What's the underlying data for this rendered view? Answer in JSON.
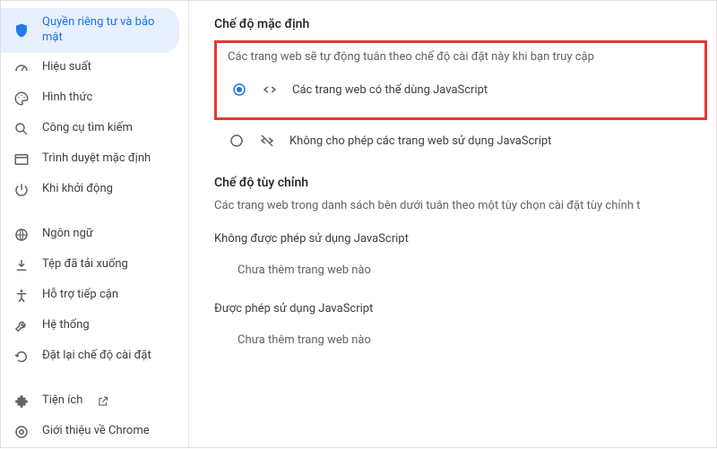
{
  "sidebar": {
    "items": [
      {
        "label": "Quyền riêng tư và bảo mật"
      },
      {
        "label": "Hiệu suất"
      },
      {
        "label": "Hình thức"
      },
      {
        "label": "Công cụ tìm kiếm"
      },
      {
        "label": "Trình duyệt mặc định"
      },
      {
        "label": "Khi khởi động"
      },
      {
        "label": "Ngôn ngữ"
      },
      {
        "label": "Tệp đã tải xuống"
      },
      {
        "label": "Hỗ trợ tiếp cận"
      },
      {
        "label": "Hệ thống"
      },
      {
        "label": "Đặt lại chế độ cài đặt"
      },
      {
        "label": "Tiện ích"
      },
      {
        "label": "Giới thiệu về Chrome"
      }
    ]
  },
  "main": {
    "default_section_title": "Chế độ mặc định",
    "default_desc": "Các trang web sẽ tự động tuân theo chế độ cài đặt này khi bạn truy cập",
    "option_allow": "Các trang web có thể dùng JavaScript",
    "option_block": "Không cho phép các trang web sử dụng JavaScript",
    "custom_section_title": "Chế độ tùy chỉnh",
    "custom_desc": "Các trang web trong danh sách bên dưới tuân theo một tùy chọn cài đặt tùy chỉnh t",
    "blocked_title": "Không được phép sử dụng JavaScript",
    "allowed_title": "Được phép sử dụng JavaScript",
    "empty_text": "Chưa thêm trang web nào"
  }
}
